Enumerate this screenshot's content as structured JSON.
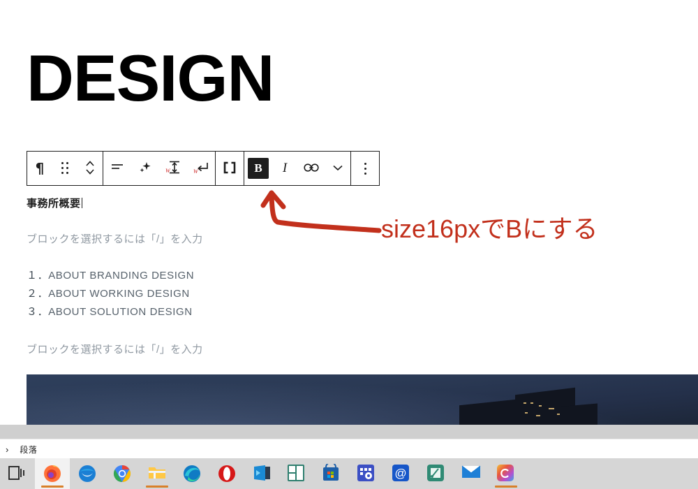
{
  "editor": {
    "page_title": "DESIGN",
    "blocks": {
      "heading_text": "事務所概要",
      "placeholder_1": "ブロックを選択するには「/」を入力",
      "placeholder_2": "ブロックを選択するには「/」を入力",
      "list": [
        {
          "number": "１．",
          "text": "ABOUT BRANDING DESIGN"
        },
        {
          "number": "２．",
          "text": "ABOUT WORKING DESIGN"
        },
        {
          "number": "３．",
          "text": "ABOUT SOLUTION DESIGN"
        }
      ]
    }
  },
  "toolbar": {
    "groups": [
      {
        "buttons": [
          {
            "name": "block-type-paragraph",
            "icon": "pilcrow-icon",
            "glyph": "¶"
          },
          {
            "name": "drag-handle",
            "icon": "drag-dots-icon",
            "glyph": ""
          },
          {
            "name": "move-up-down",
            "icon": "chevron-up-down-icon",
            "glyph": ""
          }
        ]
      },
      {
        "buttons": [
          {
            "name": "align-text",
            "icon": "align-icon",
            "glyph": ""
          },
          {
            "name": "ai-sparkle",
            "icon": "sparkle-icon",
            "glyph": ""
          },
          {
            "name": "line-height",
            "icon": "line-height-icon",
            "glyph": ""
          },
          {
            "name": "line-break",
            "icon": "return-arrow-icon",
            "glyph": ""
          }
        ]
      },
      {
        "buttons": [
          {
            "name": "shortcode",
            "icon": "brackets-icon",
            "glyph": "[]"
          }
        ]
      },
      {
        "buttons": [
          {
            "name": "bold",
            "icon": "bold-icon",
            "glyph": "B",
            "active": true
          },
          {
            "name": "italic",
            "icon": "italic-icon",
            "glyph": "I"
          },
          {
            "name": "link",
            "icon": "link-icon",
            "glyph": ""
          },
          {
            "name": "more-formatting",
            "icon": "chevron-down-icon",
            "glyph": ""
          }
        ]
      },
      {
        "buttons": [
          {
            "name": "block-options",
            "icon": "vertical-dots-icon",
            "glyph": ""
          }
        ]
      }
    ]
  },
  "annotation": {
    "text": "size16pxでBにする",
    "color": "#c2301c"
  },
  "breadcrumb": {
    "chevron": "›",
    "label": "段落"
  },
  "taskbar": {
    "items": [
      {
        "name": "task-view",
        "icon": "task-view-icon",
        "active": false
      },
      {
        "name": "firefox",
        "icon": "firefox-icon",
        "active": true
      },
      {
        "name": "thunderbird",
        "icon": "thunderbird-icon",
        "active": false
      },
      {
        "name": "chrome",
        "icon": "chrome-icon",
        "active": false
      },
      {
        "name": "file-explorer",
        "icon": "folder-icon",
        "active": true
      },
      {
        "name": "edge",
        "icon": "edge-icon",
        "active": false
      },
      {
        "name": "opera",
        "icon": "opera-icon",
        "active": false
      },
      {
        "name": "movies-tv",
        "icon": "movies-tv-icon",
        "active": false
      },
      {
        "name": "panel-app",
        "icon": "panel-icon",
        "active": false
      },
      {
        "name": "microsoft-store",
        "icon": "store-icon",
        "active": false
      },
      {
        "name": "settings-grid-app",
        "icon": "grid-settings-icon",
        "active": false
      },
      {
        "name": "mail-at-app",
        "icon": "at-sign-icon",
        "active": false
      },
      {
        "name": "capture-app",
        "icon": "capture-icon",
        "active": false
      },
      {
        "name": "mail-envelope",
        "icon": "envelope-icon",
        "active": false
      },
      {
        "name": "creative-cloud",
        "icon": "creative-cloud-icon",
        "active": true
      }
    ]
  },
  "colors": {
    "accent_underline": "#d8802a",
    "toolbar_border": "#1e1e1e",
    "placeholder_text": "#8f98a1",
    "annotation_red": "#c2301c"
  }
}
